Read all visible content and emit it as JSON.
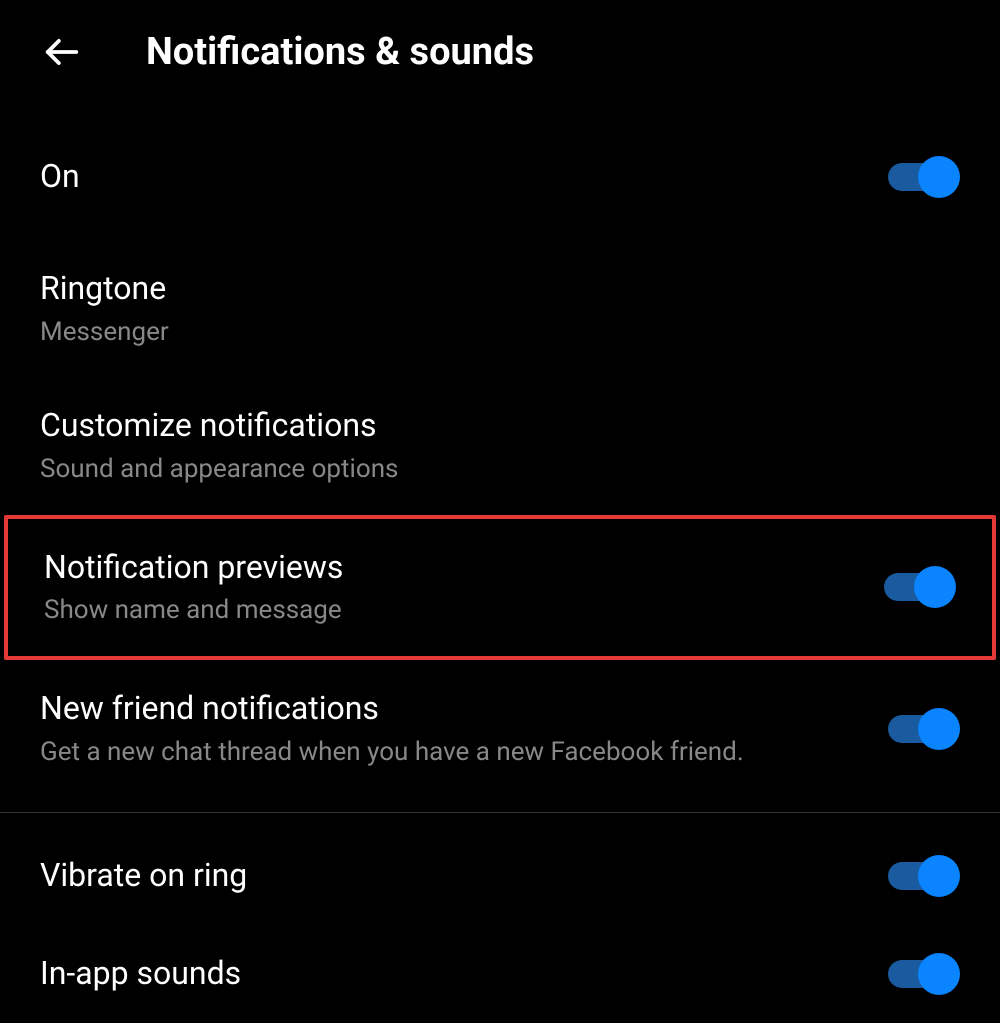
{
  "header": {
    "title": "Notifications & sounds"
  },
  "settings": {
    "on": {
      "title": "On",
      "enabled": true
    },
    "ringtone": {
      "title": "Ringtone",
      "subtitle": "Messenger"
    },
    "customize": {
      "title": "Customize notifications",
      "subtitle": "Sound and appearance options"
    },
    "previews": {
      "title": "Notification previews",
      "subtitle": "Show name and message",
      "enabled": true,
      "highlighted": true
    },
    "newfriend": {
      "title": "New friend notifications",
      "subtitle": "Get a new chat thread when you have a new Facebook friend.",
      "enabled": true
    },
    "vibrate": {
      "title": "Vibrate on ring",
      "enabled": true
    },
    "inappsounds": {
      "title": "In-app sounds",
      "enabled": true
    }
  }
}
